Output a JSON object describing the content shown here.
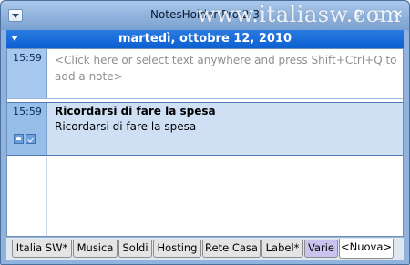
{
  "window": {
    "title": "NotesHolder Pro 2.3",
    "watermark": "www.italiasw.com"
  },
  "date_header": "martedì, ottobre 12, 2010",
  "notes": [
    {
      "time": "15:59",
      "placeholder": "<Click here or select text anywhere and press Shift+Ctrl+Q to add a note>"
    },
    {
      "time": "15:59",
      "title": "Ricordarsi di fare la spesa",
      "body": "Ricordarsi di fare la spesa"
    }
  ],
  "tabs": [
    {
      "label": "Italia SW*"
    },
    {
      "label": "Musica"
    },
    {
      "label": "Soldi"
    },
    {
      "label": "Hosting"
    },
    {
      "label": "Rete Casa"
    },
    {
      "label": "Label*"
    },
    {
      "label": "Varie"
    },
    {
      "label": "<Nuova>"
    }
  ],
  "colors": {
    "accent": "#0b5fd0",
    "selected_note": "#cfe0f5",
    "gutter": "#a6c8ee"
  }
}
